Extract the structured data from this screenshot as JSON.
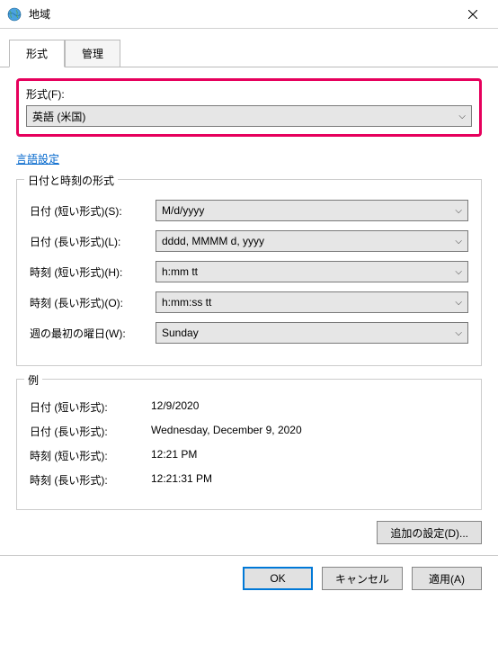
{
  "window": {
    "title": "地域"
  },
  "tabs": {
    "format": "形式",
    "admin": "管理"
  },
  "format_section": {
    "label": "形式(F):",
    "selected": "英語 (米国)"
  },
  "language_link": "言語設定",
  "datetime_formats": {
    "legend": "日付と時刻の形式",
    "short_date_label": "日付 (短い形式)(S):",
    "short_date_value": "M/d/yyyy",
    "long_date_label": "日付 (長い形式)(L):",
    "long_date_value": "dddd, MMMM d, yyyy",
    "short_time_label": "時刻 (短い形式)(H):",
    "short_time_value": "h:mm tt",
    "long_time_label": "時刻 (長い形式)(O):",
    "long_time_value": "h:mm:ss tt",
    "first_dow_label": "週の最初の曜日(W):",
    "first_dow_value": "Sunday"
  },
  "examples": {
    "legend": "例",
    "short_date_label": "日付 (短い形式):",
    "short_date_value": "12/9/2020",
    "long_date_label": "日付 (長い形式):",
    "long_date_value": "Wednesday, December 9, 2020",
    "short_time_label": "時刻 (短い形式):",
    "short_time_value": "12:21 PM",
    "long_time_label": "時刻 (長い形式):",
    "long_time_value": "12:21:31 PM"
  },
  "buttons": {
    "additional": "追加の設定(D)...",
    "ok": "OK",
    "cancel": "キャンセル",
    "apply": "適用(A)"
  }
}
